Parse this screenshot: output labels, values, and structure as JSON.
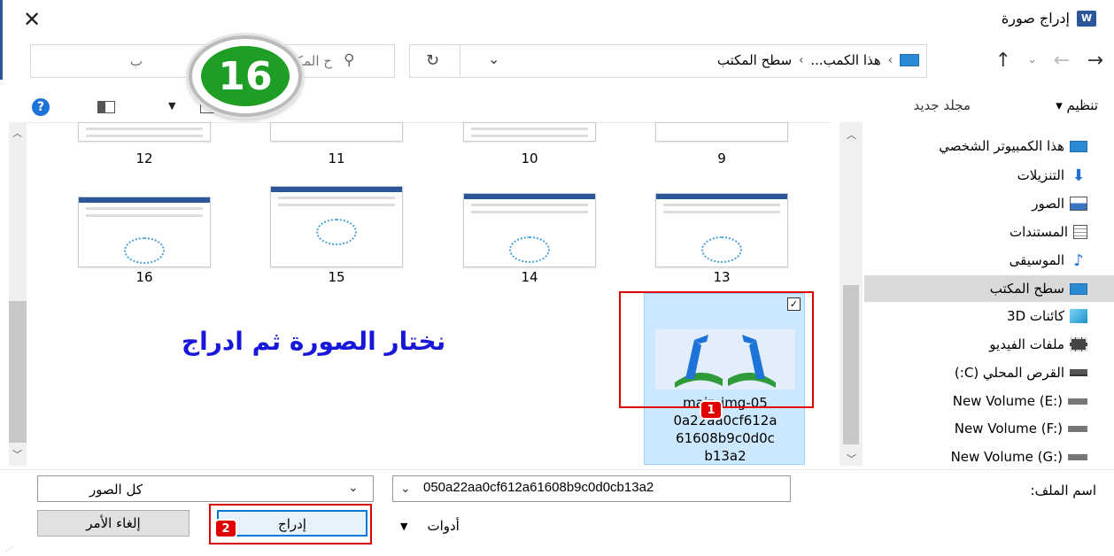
{
  "window": {
    "title": "إدراج صورة",
    "app_badge": "W",
    "close_glyph": "✕"
  },
  "address": {
    "crumbs": [
      "هذا الكمب...",
      "سطح المكتب"
    ],
    "crumb_sep": "›",
    "refresh_glyph": "↻",
    "drop_glyph": "⌄"
  },
  "nav_buttons": {
    "back": "←",
    "forward": "→",
    "recent": "⌄",
    "up": "↑"
  },
  "search": {
    "placeholder_visible": "ح المكتب",
    "prefix_visible": "ب"
  },
  "toolbar": {
    "organize": "تنظيم ▾",
    "new_folder": "مجلد جديد",
    "help": "?",
    "view_drop": "▼"
  },
  "step_badge": "16",
  "files": [
    {
      "label": "12"
    },
    {
      "label": "11"
    },
    {
      "label": "10"
    },
    {
      "label": "9"
    },
    {
      "label": "16"
    },
    {
      "label": "15"
    },
    {
      "label": "14"
    },
    {
      "label": "13"
    }
  ],
  "selected_file": {
    "name": "main-img-050a22aa0cf612a61608b9c0d0cb13a2",
    "name_lines": [
      "main-img-05",
      "0a22aa0cf612a",
      "61608b9c0d0c",
      "b13a2"
    ],
    "check": "✓"
  },
  "annotation": "نختار الصورة ثم ادراج",
  "markers": {
    "first": "1",
    "second": "2"
  },
  "nav_pane": [
    {
      "label": "هذا الكمبيوتر الشخصي",
      "icon": "pc-icon"
    },
    {
      "label": "التنزيلات",
      "icon": "downloads-icon"
    },
    {
      "label": "الصور",
      "icon": "pictures-icon"
    },
    {
      "label": "المستندات",
      "icon": "documents-icon"
    },
    {
      "label": "الموسيقى",
      "icon": "music-icon"
    },
    {
      "label": "سطح المكتب",
      "icon": "desktop-icon",
      "selected": true
    },
    {
      "label": "كائنات ثلاثية الأبعاد",
      "display": "كائنات 3D",
      "icon": "3d-objects-icon"
    },
    {
      "label": "ملفات الفيديو",
      "icon": "videos-icon"
    },
    {
      "label": "القرص المحلي (C:)",
      "icon": "local-disk-icon"
    },
    {
      "label": "New Volume (E:)",
      "icon": "drive-icon"
    },
    {
      "label": "New Volume (F:)",
      "icon": "drive-icon"
    },
    {
      "label": "New Volume (G:)",
      "icon": "drive-icon"
    }
  ],
  "bottom": {
    "file_name_label": "اسم الملف:",
    "file_name_value": "050a22aa0cf612a61608b9c0d0cb13a2",
    "filter_value": "كل الصور",
    "tools_label": "أدوات",
    "tools_drop": "▼",
    "insert_button": "إدراج",
    "cancel_button": "إلغاء الأمر",
    "drop_glyph": "⌄"
  },
  "colors": {
    "accent": "#2b579a",
    "selection": "#cce8ff",
    "highlight_red": "#e00000",
    "annotation_blue": "#1717d9",
    "badge_green": "#1f9e25"
  }
}
